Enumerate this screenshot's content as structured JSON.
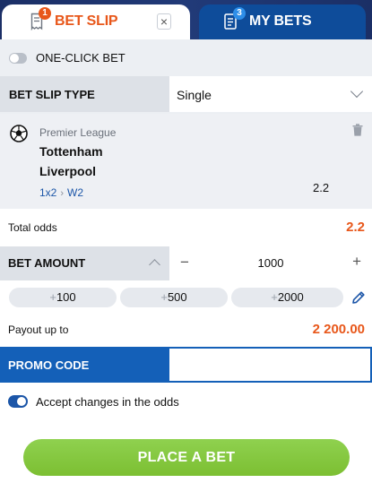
{
  "tabs": {
    "bet_slip": {
      "label": "BET SLIP",
      "badge": "1"
    },
    "my_bets": {
      "label": "MY BETS",
      "badge": "3"
    },
    "close": "×"
  },
  "one_click": {
    "label": "ONE-CLICK BET",
    "enabled": false
  },
  "bet_slip_type": {
    "label": "BET SLIP TYPE",
    "value": "Single"
  },
  "bet": {
    "league": "Premier League",
    "team1": "Tottenham",
    "team2": "Liverpool",
    "market": "1x2",
    "selection": "W2",
    "odds": "2.2"
  },
  "total_odds": {
    "label": "Total odds",
    "value": "2.2"
  },
  "bet_amount": {
    "label": "BET AMOUNT",
    "minus": "−",
    "value": "1000",
    "plus": "+"
  },
  "quick_amounts": [
    {
      "sign": "+",
      "value": "100"
    },
    {
      "sign": "+",
      "value": "500"
    },
    {
      "sign": "+",
      "value": "2000"
    }
  ],
  "payout": {
    "label": "Payout up to",
    "value": "2 200.00"
  },
  "promo": {
    "label": "PROMO CODE",
    "value": ""
  },
  "accept_changes": {
    "label": "Accept changes in the odds",
    "enabled": true
  },
  "place_bet": {
    "label": "PLACE A BET"
  },
  "colors": {
    "accent": "#e8571a",
    "primary": "#1460b8",
    "cta": "#7cbf32"
  }
}
